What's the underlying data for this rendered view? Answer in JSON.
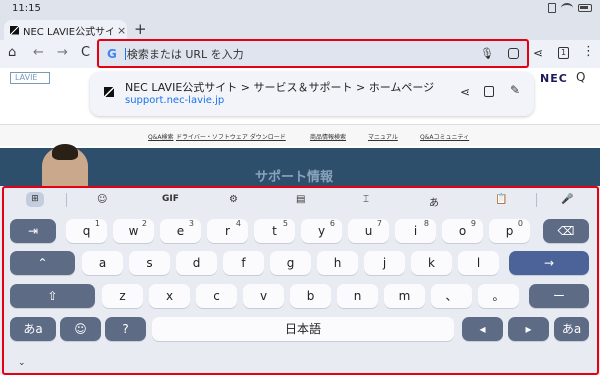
{
  "status_bar": {
    "time": "11:15"
  },
  "tab": {
    "title": "NEC LAVIE公式サイ",
    "close": "×",
    "new_tab": "+"
  },
  "toolbar": {
    "home": "⌂",
    "back": "←",
    "forward": "→",
    "reload": "C",
    "omnibox_placeholder": "検索または URL を入力",
    "google_logo": "G",
    "mic": "🎙",
    "share": "⋖",
    "tabs_count": "1",
    "menu": "⋮"
  },
  "page": {
    "logo": "LAVIE",
    "nec_logo": "NEC",
    "search": "Q",
    "nav_links": [
      "Q&A検索",
      "ドライバー・ソフトウェア ダウンロード",
      "商品情報検索",
      "マニュアル",
      "Q&Aコミュニティ"
    ],
    "hero_title": "サポート情報"
  },
  "suggestion": {
    "title": "NEC LAVIE公式サイト > サービス＆サポート > ホームページ",
    "url": "support.nec-lavie.jp",
    "share": "⋖",
    "edit": "✎"
  },
  "keyboard": {
    "toolbar": {
      "apps": "⊞",
      "sticker": "☺",
      "gif": "GIF",
      "settings": "⚙",
      "layout": "▤",
      "text_edit": "⌶",
      "translate": "あ",
      "clipboard": "📋",
      "mic": "🎤"
    },
    "row1": [
      {
        "key": "q",
        "sup": "1"
      },
      {
        "key": "w",
        "sup": "2"
      },
      {
        "key": "e",
        "sup": "3"
      },
      {
        "key": "r",
        "sup": "4"
      },
      {
        "key": "t",
        "sup": "5"
      },
      {
        "key": "y",
        "sup": "6"
      },
      {
        "key": "u",
        "sup": "7"
      },
      {
        "key": "i",
        "sup": "8"
      },
      {
        "key": "o",
        "sup": "9"
      },
      {
        "key": "p",
        "sup": "0"
      }
    ],
    "row2": [
      "a",
      "s",
      "d",
      "f",
      "g",
      "h",
      "j",
      "k",
      "l"
    ],
    "row3": [
      "z",
      "x",
      "c",
      "v",
      "b",
      "n",
      "m",
      "、",
      "。"
    ],
    "tab_key": "⇥",
    "backspace": "⌫",
    "caps": "⌃",
    "enter": "→",
    "shift": "⇧",
    "dash": "ー",
    "lang_left": "あa",
    "emoji": "☺",
    "symbols": "?",
    "space": "日本語",
    "arrow_left": "◂",
    "arrow_right": "▸",
    "lang_right": "あa",
    "collapse": "⌄"
  }
}
